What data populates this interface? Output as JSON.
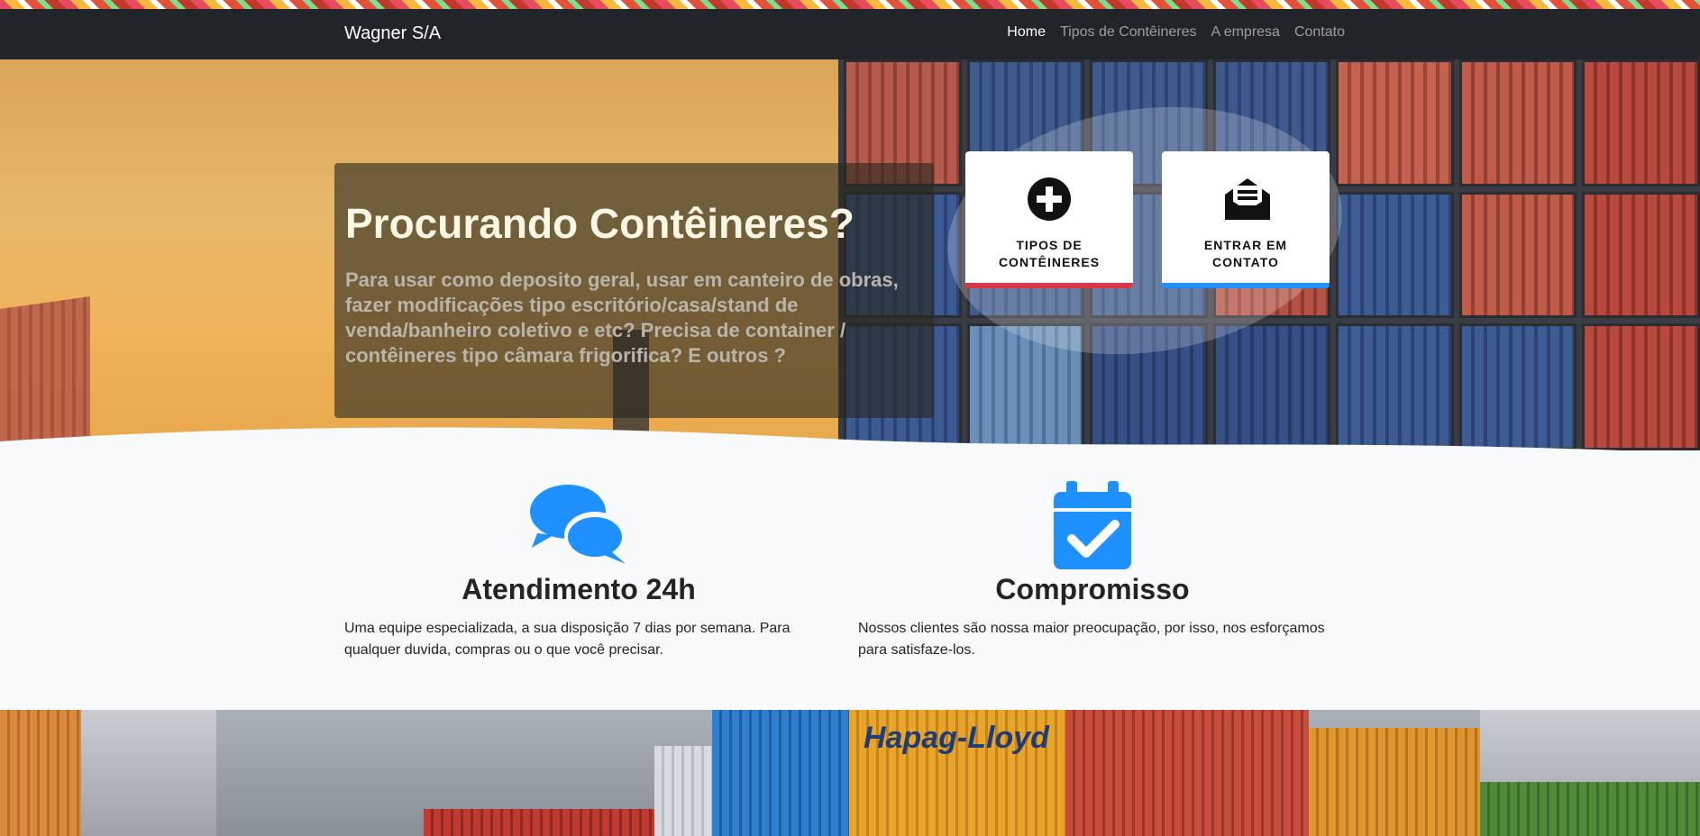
{
  "navbar": {
    "brand": "Wagner S/A",
    "links": [
      {
        "label": "Home",
        "active": true
      },
      {
        "label": "Tipos de Contêineres",
        "active": false
      },
      {
        "label": "A empresa",
        "active": false
      },
      {
        "label": "Contato",
        "active": false
      }
    ]
  },
  "hero": {
    "title": "Procurando Contêineres?",
    "text": "Para usar como deposito geral, usar em canteiro de obras, fazer modificações tipo escritório/casa/stand de venda/banheiro coletivo e etc? Precisa de container / contêineres tipo câmara frigorifica? E outros ?",
    "cards": [
      {
        "label": "TIPOS DE CONTÊINERES",
        "icon": "plus-circle-icon",
        "accent": "#dc3545"
      },
      {
        "label": "ENTRAR EM CONTATO",
        "icon": "envelope-open-text-icon",
        "accent": "#1e90ff"
      }
    ]
  },
  "features": [
    {
      "icon": "comments-icon",
      "title": "Atendimento 24h",
      "text": "Uma equipe especializada, a sua disposição 7 dias por semana. Para qualquer duvida, compras ou o que você precisar."
    },
    {
      "icon": "calendar-check-icon",
      "title": "Compromisso",
      "text": "Nossos clientes são nossa maior preocupação, por isso, nos esforçamos para satisfaze-los."
    }
  ],
  "bottom": {
    "container_text": "Hapag-Lloyd"
  },
  "colors": {
    "navbar_bg": "#212529",
    "accent_blue": "#1e90ff",
    "accent_red": "#dc3545",
    "page_bg": "#f8f9fa"
  }
}
